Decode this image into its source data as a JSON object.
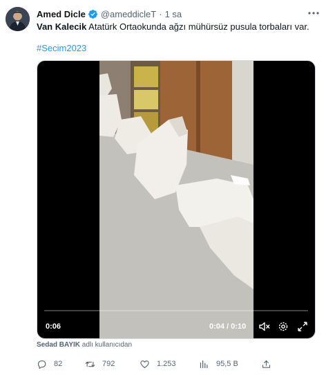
{
  "author": {
    "name": "Amed Dicle",
    "handle": "@ameddicleT",
    "separator": "·",
    "time": "1 sa"
  },
  "tweet": {
    "text_bold": "Van Kalecik",
    "text_rest": " Atatürk Ortaokunda ağzı mühürsüz pusula torbaları var.",
    "hashtag": "#Secim2023"
  },
  "video": {
    "elapsed": "0:06",
    "position_and_duration": "0:04 / 0:10"
  },
  "attribution": {
    "user": "Sedad BAYIK",
    "suffix": " adlı kullanıcıdan"
  },
  "actions": {
    "replies": "82",
    "retweets": "792",
    "likes": "1.253",
    "views": "95,5 B"
  },
  "icons": [
    "verified-icon",
    "more-icon",
    "volume-icon",
    "settings-icon",
    "fullscreen-icon",
    "reply-icon",
    "retweet-icon",
    "like-icon",
    "views-icon",
    "share-icon"
  ],
  "colors": {
    "accent": "#1d9bf0",
    "text": "#0f1419",
    "muted": "#536471"
  }
}
